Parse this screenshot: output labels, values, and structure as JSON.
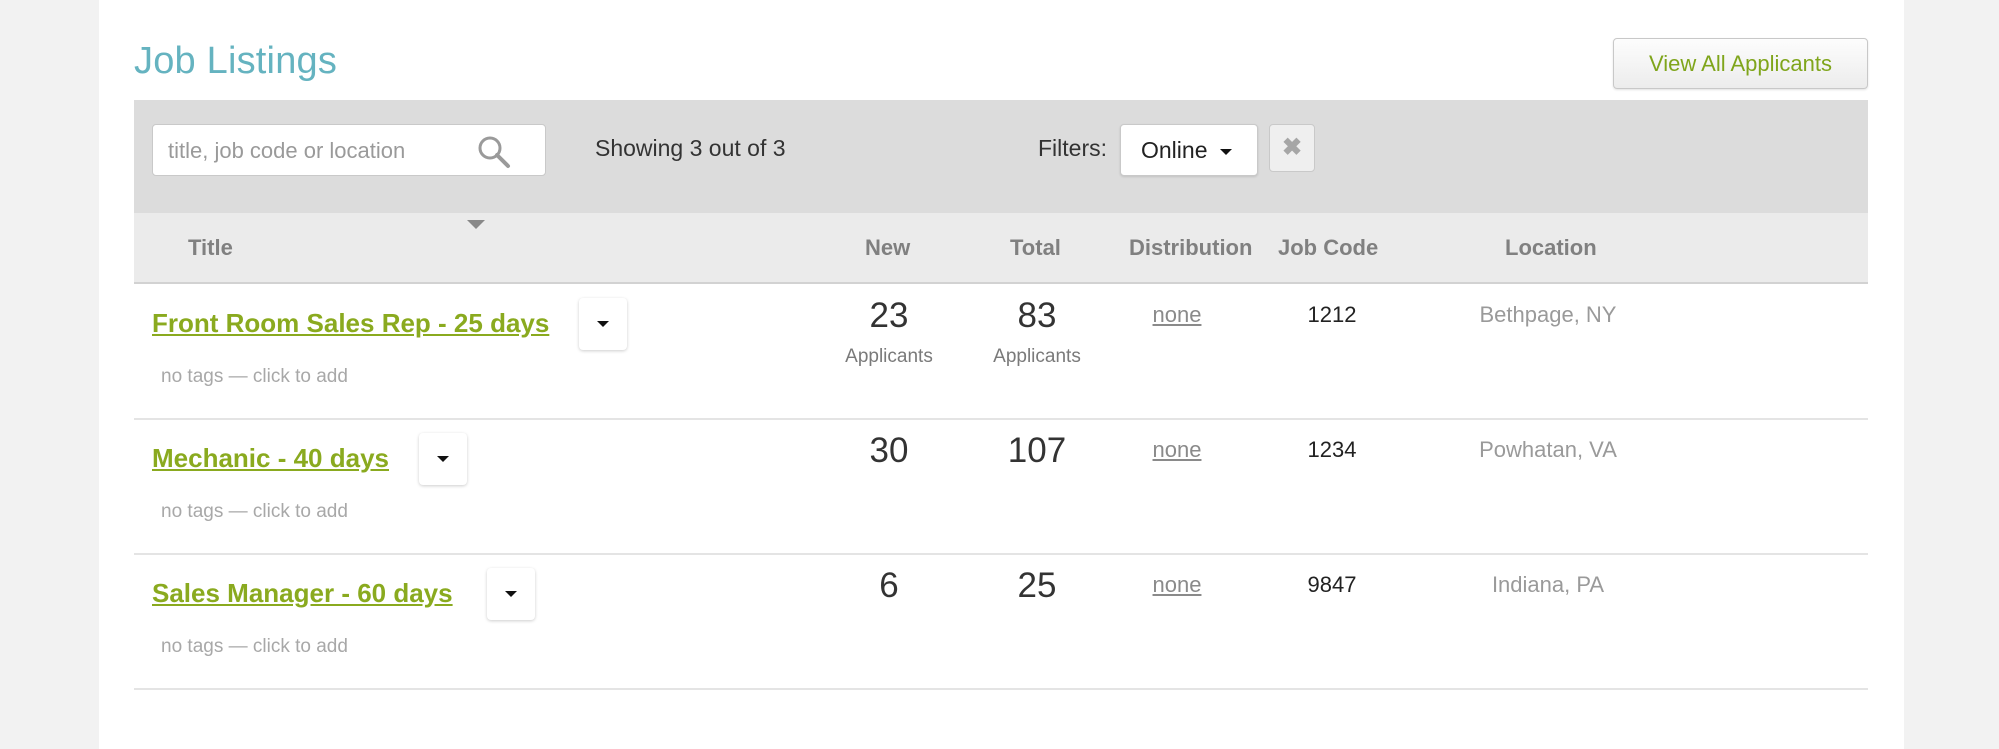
{
  "page": {
    "title": "Job Listings",
    "view_all_label": "View All Applicants"
  },
  "toolbar": {
    "search_placeholder": "title, job code or location",
    "showing_text": "Showing 3 out of 3",
    "filters_label": "Filters:",
    "filter_value": "Online",
    "clear_icon": "close-icon"
  },
  "table": {
    "columns": {
      "title": "Title",
      "new": "New",
      "total": "Total",
      "distribution": "Distribution",
      "job_code": "Job Code",
      "location": "Location"
    },
    "rows": [
      {
        "title": "Front Room Sales Rep - 25 days",
        "tags": "no tags — click to add",
        "new": "23",
        "new_sub": "Applicants",
        "total": "83",
        "total_sub": "Applicants",
        "distribution": "none",
        "job_code": "1212",
        "location": "Bethpage, NY"
      },
      {
        "title": "Mechanic - 40 days",
        "tags": "no tags — click to add",
        "new": "30",
        "total": "107",
        "distribution": "none",
        "job_code": "1234",
        "location": "Powhatan, VA"
      },
      {
        "title": "Sales Manager - 60 days",
        "tags": "no tags — click to add",
        "new": "6",
        "total": "25",
        "distribution": "none",
        "job_code": "9847",
        "location": "Indiana, PA"
      }
    ]
  },
  "colors": {
    "title": "#65b3c0",
    "link": "#8aaa1f",
    "toolbar_bg": "#dcdcdc",
    "header_bg": "#ebebeb"
  }
}
